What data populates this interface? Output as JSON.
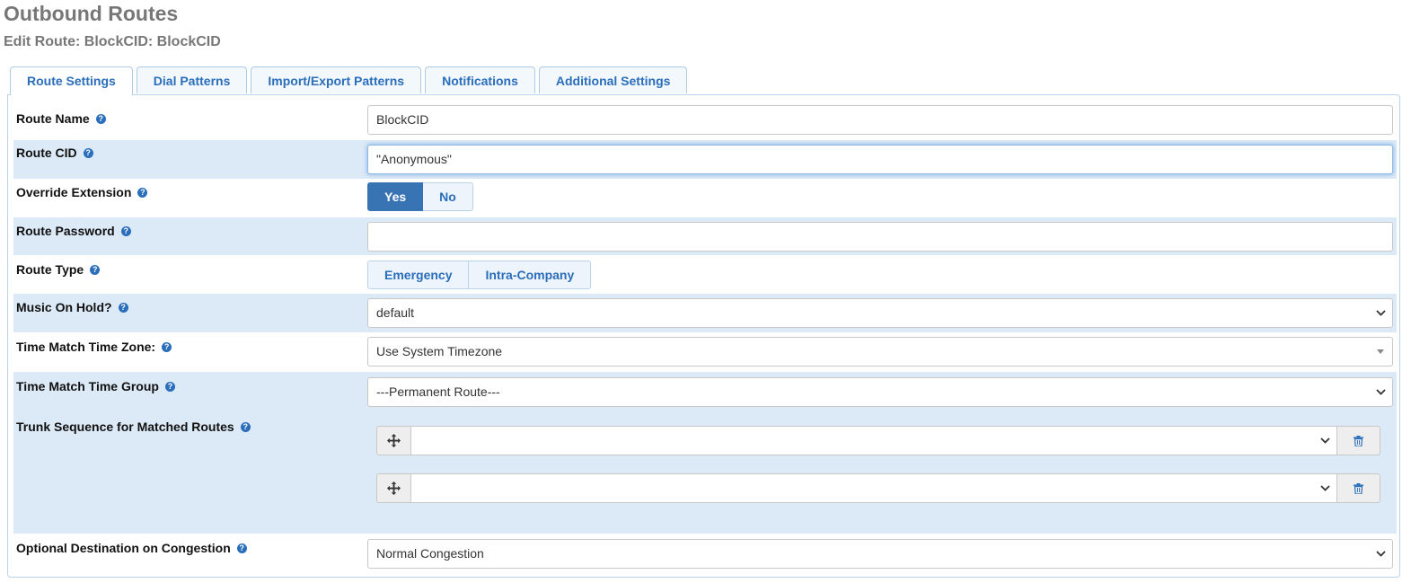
{
  "header": {
    "title": "Outbound Routes",
    "subtitle": "Edit Route: BlockCID: BlockCID"
  },
  "tabs": [
    {
      "label": "Route Settings",
      "active": true
    },
    {
      "label": "Dial Patterns",
      "active": false
    },
    {
      "label": "Import/Export Patterns",
      "active": false
    },
    {
      "label": "Notifications",
      "active": false
    },
    {
      "label": "Additional Settings",
      "active": false
    }
  ],
  "form": {
    "route_name": {
      "label": "Route Name",
      "value": "BlockCID"
    },
    "route_cid": {
      "label": "Route CID",
      "value": "\"Anonymous\""
    },
    "override_extension": {
      "label": "Override Extension",
      "options": [
        "Yes",
        "No"
      ],
      "selected": "Yes"
    },
    "route_password": {
      "label": "Route Password",
      "value": ""
    },
    "route_type": {
      "label": "Route Type",
      "options": [
        "Emergency",
        "Intra-Company"
      ]
    },
    "music_on_hold": {
      "label": "Music On Hold?",
      "value": "default"
    },
    "time_zone": {
      "label": "Time Match Time Zone:",
      "value": "Use System Timezone"
    },
    "time_group": {
      "label": "Time Match Time Group",
      "value": "---Permanent Route---"
    },
    "trunk_sequence": {
      "label": "Trunk Sequence for Matched Routes",
      "trunks": [
        "",
        ""
      ]
    },
    "congestion": {
      "label": "Optional Destination on Congestion",
      "value": "Normal Congestion"
    }
  },
  "icons": {
    "help": "question-circle-icon",
    "move": "arrows-move-icon",
    "delete": "trash-icon",
    "dropdown": "chevron-down-icon"
  },
  "colors": {
    "accent": "#2a6ebb",
    "active_button": "#3873b4",
    "row_shade": "#dce9f7"
  }
}
